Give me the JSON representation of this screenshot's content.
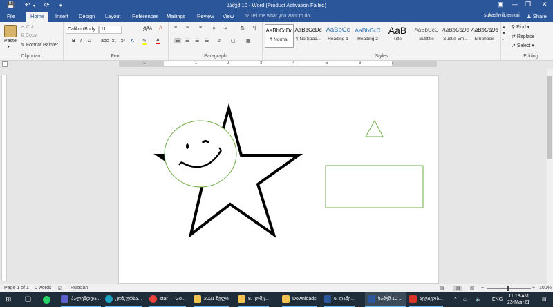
{
  "title_bar": {
    "title": "სამუშ 10 - Word (Product Activation Failed)"
  },
  "tabs": [
    "File",
    "Home",
    "Insert",
    "Design",
    "Layout",
    "References",
    "Mailings",
    "Review",
    "View"
  ],
  "active_tab": "Home",
  "tell_me": "Tell me what you want to do...",
  "user": "sukashvili.temuri",
  "share": "Share",
  "clipboard": {
    "paste": "Paste",
    "cut": "Cut",
    "copy": "Copy",
    "format_painter": "Format Painter",
    "label": "Clipboard"
  },
  "font": {
    "name": "Calibri (Body",
    "size": "11",
    "label": "Font",
    "bold": "B",
    "italic": "I",
    "underline": "U",
    "strike": "abc",
    "sub": "x₂",
    "sup": "x²",
    "grow": "A",
    "shrink": "A",
    "case": "Aa",
    "clear": "A"
  },
  "paragraph": {
    "label": "Paragraph",
    "pilcrow": "¶"
  },
  "styles": {
    "label": "Styles",
    "items": [
      {
        "preview": "AaBbCcDc",
        "name": "¶ Normal"
      },
      {
        "preview": "AaBbCcDc",
        "name": "¶ No Spac..."
      },
      {
        "preview": "AaBbCc",
        "name": "Heading 1"
      },
      {
        "preview": "AaBbCcC",
        "name": "Heading 2"
      },
      {
        "preview": "AaB",
        "name": "Title"
      },
      {
        "preview": "AaBbCcC",
        "name": "Subtitle"
      },
      {
        "preview": "AaBbCcDc",
        "name": "Subtle Em..."
      },
      {
        "preview": "AaBbCcDc",
        "name": "Emphasis"
      }
    ]
  },
  "editing": {
    "find": "Find",
    "replace": "Replace",
    "select": "Select",
    "label": "Editing"
  },
  "ruler_numbers": [
    "1",
    "1",
    "2",
    "3",
    "4",
    "5",
    "6",
    "7"
  ],
  "status": {
    "page": "Page 1 of 1",
    "words": "0 words",
    "language": "Russian",
    "zoom": "100%"
  },
  "taskbar": {
    "items": [
      {
        "label": "პალენდდა..."
      },
      {
        "label": "კოზკურსა..."
      },
      {
        "label": "star — Go..."
      },
      {
        "label": "2021 წელი"
      },
      {
        "label": "8. კოშკ..."
      },
      {
        "label": "Downloads"
      },
      {
        "label": "6. თამე..."
      },
      {
        "label": "სამუშ 10 ..."
      },
      {
        "label": "აქტივობ..."
      }
    ],
    "lang": "ENG",
    "time": "11:13 AM",
    "date": "23-Mar-21"
  },
  "colors": {
    "accent": "#2b579a",
    "shape_outline_green": "#70ad47",
    "star": "#000000"
  }
}
